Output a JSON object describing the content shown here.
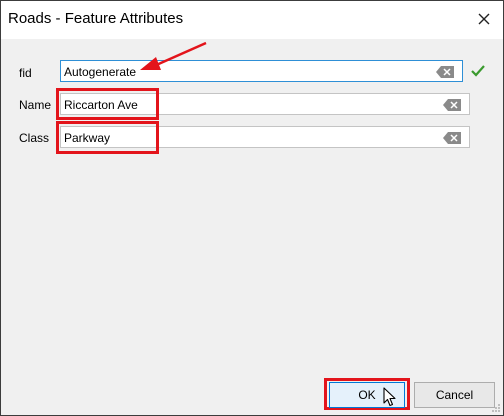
{
  "window": {
    "title": "Roads - Feature Attributes",
    "close_glyph": "✕"
  },
  "form": {
    "fid": {
      "label": "fid",
      "value": "Autogenerate",
      "valid_glyph": "✔"
    },
    "name": {
      "label": "Name",
      "value": "Riccarton Ave"
    },
    "class": {
      "label": "Class",
      "value": "Parkway"
    }
  },
  "buttons": {
    "ok_label": "OK",
    "cancel_label": "Cancel"
  },
  "colors": {
    "annotation_red": "#e3141b",
    "valid_green": "#3a9a2e",
    "focus_blue": "#2e8fd6"
  }
}
